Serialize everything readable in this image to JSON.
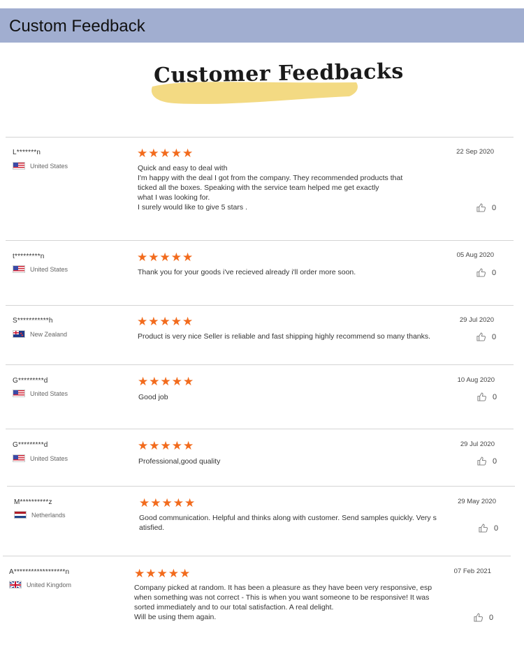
{
  "header": {
    "title": "Custom Feedback"
  },
  "banner": {
    "title": "Customer Feedbacks",
    "highlight_color": "#f2d675"
  },
  "colors": {
    "header_bg": "#a1aed0",
    "star": "#f26b1d"
  },
  "reviews": [
    {
      "name": "L*******n",
      "country": "United States",
      "flag": "us-flag-icon",
      "rating": 5,
      "stars": "★★★★★",
      "date": "22 Sep 2020",
      "likes": "0",
      "text": "Quick and easy to deal with\nI'm happy with the deal I got from the company. They recommended products that\nticked all the boxes. Speaking with the service team helped me get exactly\nwhat I was looking for.\nI surely would like to give 5 stars ."
    },
    {
      "name": "t*********n",
      "country": "United States",
      "flag": "us-flag-icon",
      "rating": 5,
      "stars": "★★★★★",
      "date": "05 Aug 2020",
      "likes": "0",
      "text": "Thank you for your goods i've recieved already i'll order more soon."
    },
    {
      "name": "S***********h",
      "country": "New Zealand",
      "flag": "nz-flag-icon",
      "rating": 5,
      "stars": "★★★★★",
      "date": "29 Jul 2020",
      "likes": "0",
      "text": "Product is very nice Seller is reliable and fast shipping highly recommend so many thanks."
    },
    {
      "name": "G*********d",
      "country": "United States",
      "flag": "us-flag-icon",
      "rating": 5,
      "stars": "★★★★★",
      "date": "10 Aug 2020",
      "likes": "0",
      "text": "Good job"
    },
    {
      "name": "G*********d",
      "country": "United States",
      "flag": "us-flag-icon",
      "rating": 5,
      "stars": "★★★★★",
      "date": "29 Jul 2020",
      "likes": "0",
      "text": "Professional,good quality"
    },
    {
      "name": "M**********z",
      "country": "Netherlands",
      "flag": "nl-flag-icon",
      "rating": 5,
      "stars": "★★★★★",
      "date": "29 May 2020",
      "likes": "0",
      "text": "Good communication. Helpful and thinks along with customer. Send samples quickly. Very s\natisfied."
    },
    {
      "name": "A******************n",
      "country": "United Kingdom",
      "flag": "uk-flag-icon",
      "rating": 5,
      "stars": "★★★★★",
      "date": "07 Feb 2021",
      "likes": "0",
      "text": "Company picked at random. It has been a pleasure as they have been very responsive, esp\nwhen something was not correct - This is when you want someone to be responsive! It was\nsorted immediately and to our total satisfaction. A real delight.\nWill be using them again."
    }
  ]
}
